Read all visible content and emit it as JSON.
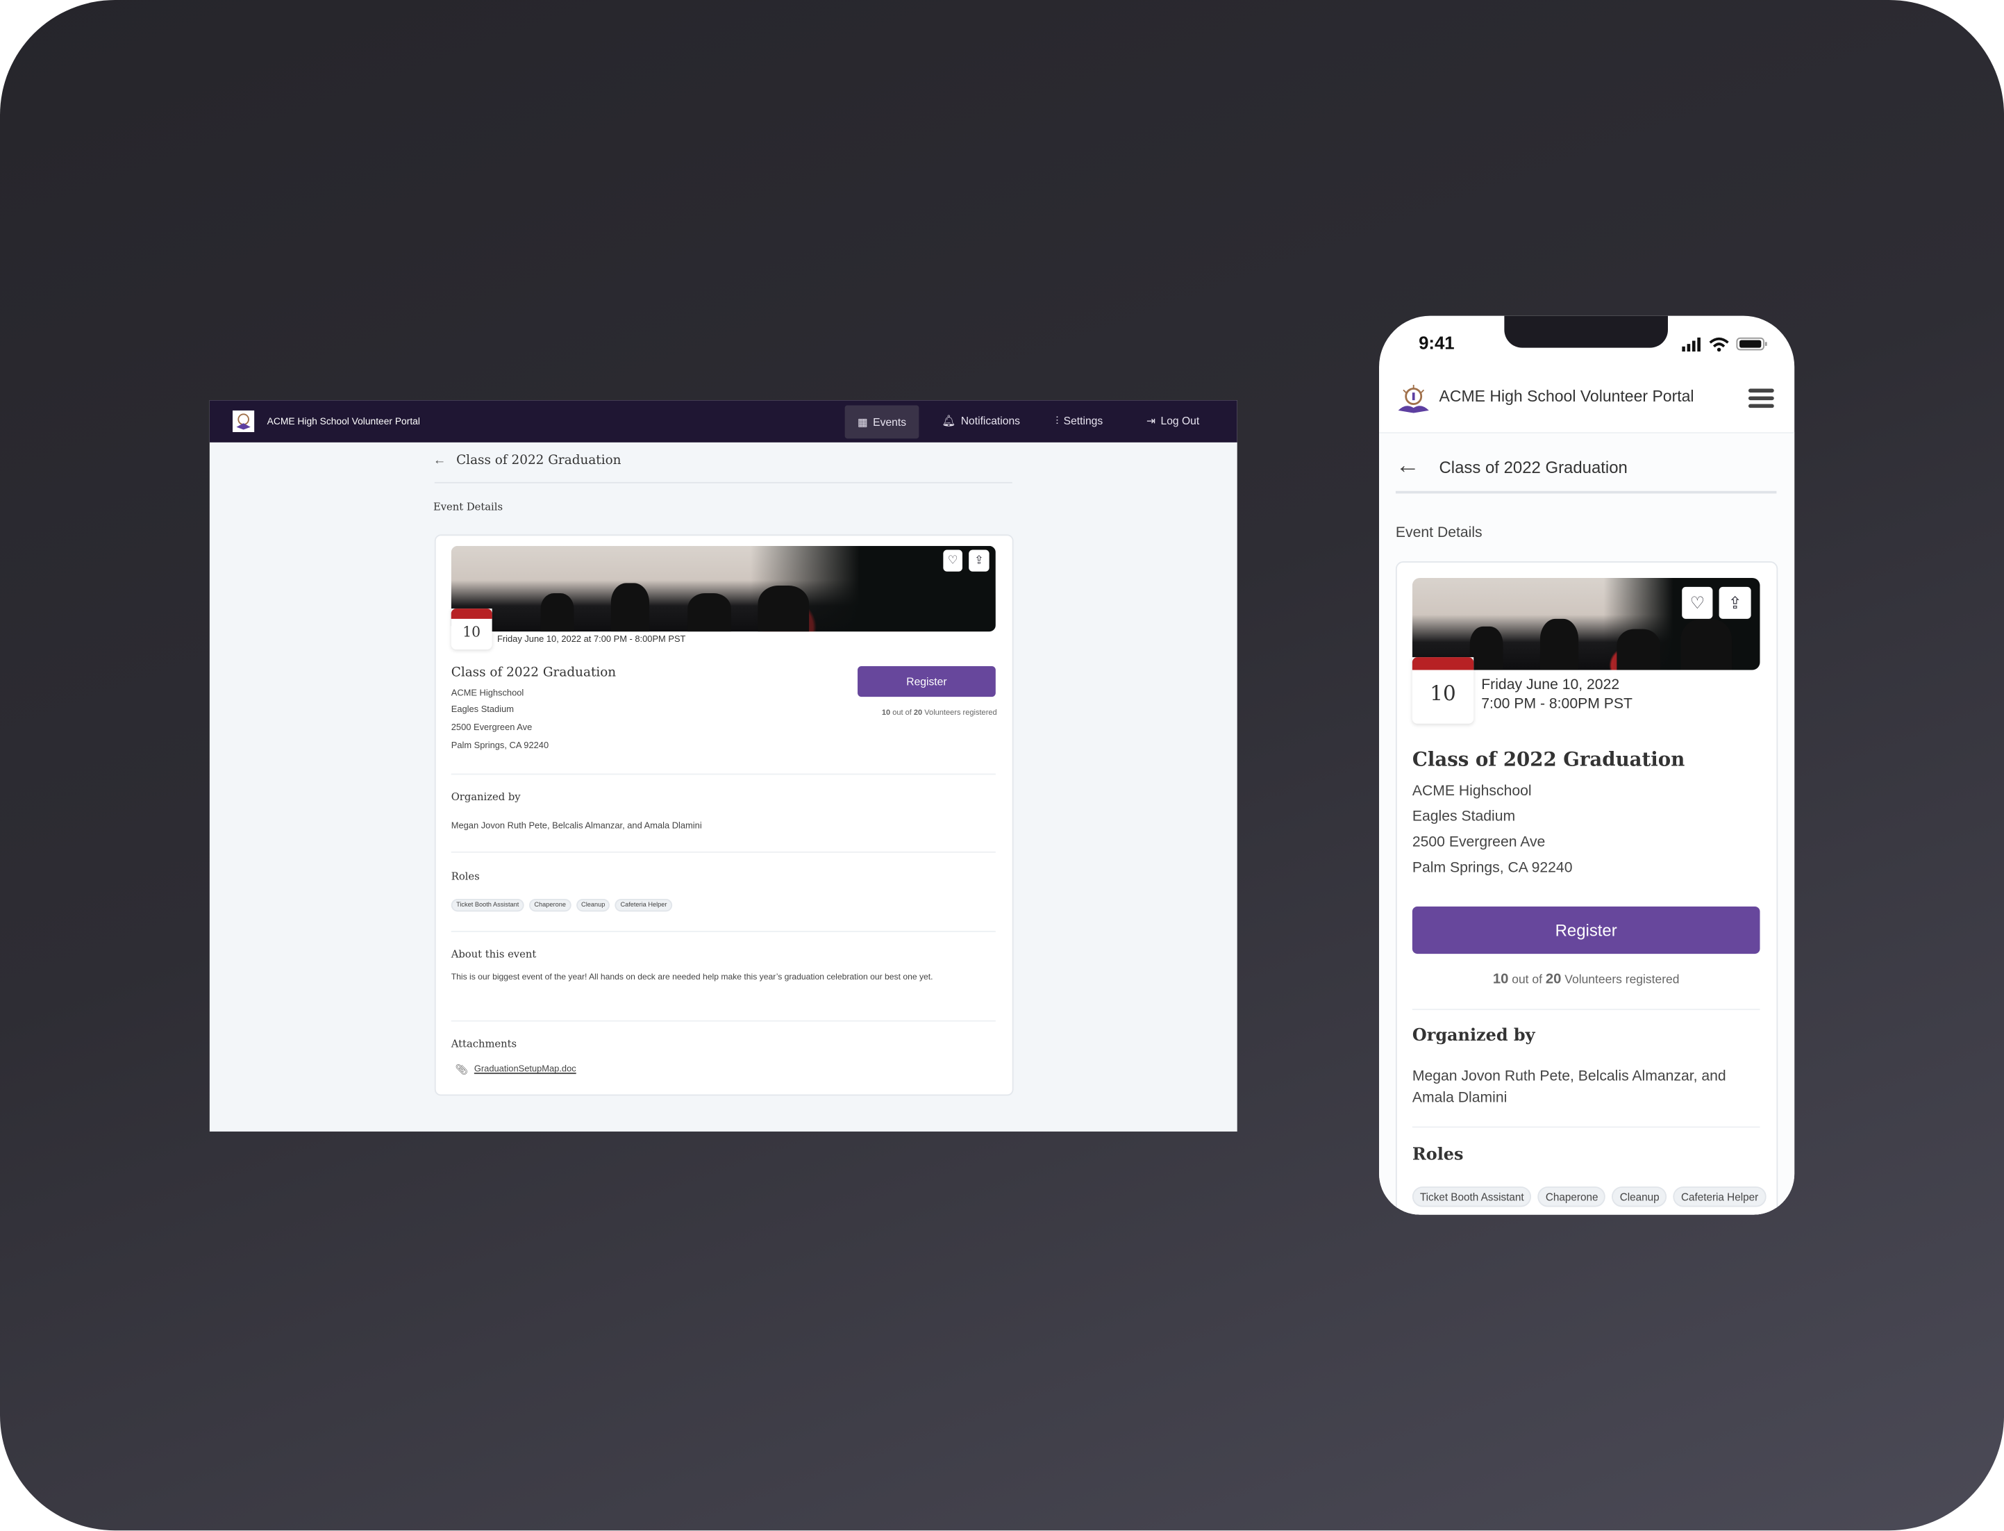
{
  "app": {
    "title": "ACME High School Volunteer Portal"
  },
  "nav": {
    "items": [
      {
        "label": "Events",
        "icon": "calendar-icon",
        "active": true
      },
      {
        "label": "Notifications",
        "icon": "bell-icon"
      },
      {
        "label": "Settings",
        "icon": "sliders-icon"
      },
      {
        "label": "Log Out",
        "icon": "logout-icon"
      }
    ]
  },
  "page": {
    "title": "Class of 2022 Graduation",
    "section_label": "Event Details"
  },
  "event": {
    "day": "10",
    "datetime_full": "Friday June 10, 2022 at 7:00 PM - 8:00PM PST",
    "date_line": "Friday June 10, 2022",
    "time_line": "7:00 PM - 8:00PM PST",
    "title": "Class of 2022 Graduation",
    "address": [
      "ACME Highschool",
      "Eagles Stadium",
      "2500 Evergreen Ave",
      "Palm Springs, CA 92240"
    ],
    "register_label": "Register",
    "registered_count": "10",
    "out_of": "out of",
    "capacity": "20",
    "volunteers_label": "Volunteers registered",
    "organized_heading": "Organized by",
    "organizers": "Megan Jovon Ruth Pete, Belcalis Almanzar, and Amala Dlamini",
    "roles_heading": "Roles",
    "roles": [
      "Ticket Booth Assistant",
      "Chaperone",
      "Cleanup",
      "Cafeteria Helper"
    ],
    "about_heading": "About this event",
    "about_text": "This is our biggest event of the year! All hands on deck are needed help make this year’s graduation celebration our best one yet.",
    "attachments_heading": "Attachments",
    "attachment": "GraduationSetupMap.doc"
  },
  "phone": {
    "time": "9:41"
  },
  "colors": {
    "nav_bg": "#1f1633",
    "accent": "#67479c",
    "badge_red": "#b72124",
    "page_bg": "#f3f6f9"
  }
}
